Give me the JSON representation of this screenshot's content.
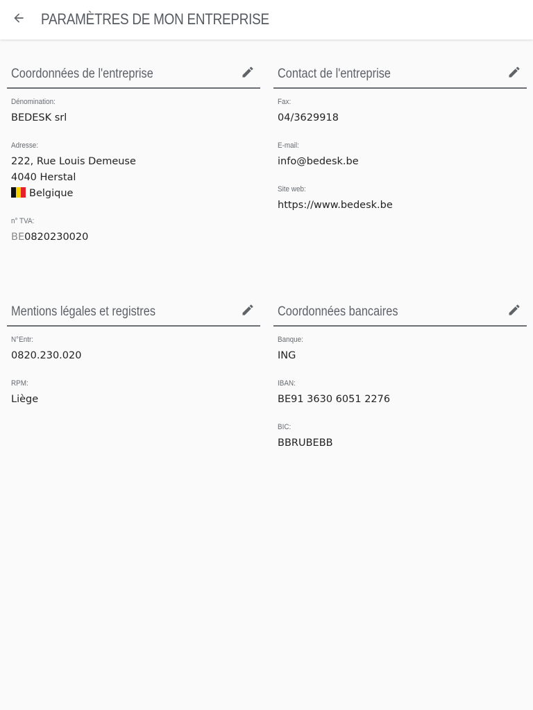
{
  "header": {
    "back_icon": "arrow-left-icon",
    "title": "PARAMÈTRES DE MON ENTREPRISE"
  },
  "colors": {
    "header_bg": "#ffffff",
    "page_bg": "#fafafa",
    "title_text": "#555a60",
    "divider": "#6b6f74",
    "icon": "#5f6368"
  },
  "company": {
    "title": "Coordonnées de l'entreprise",
    "edit_icon": "pencil-icon",
    "name_label": "Dénomination:",
    "name": "BEDESK srl",
    "address_label": "Adresse:",
    "address_line1": "222, Rue Louis Demeuse",
    "address_line2": "4040 Herstal",
    "country": "Belgique",
    "country_flag": "belgium-flag-icon",
    "vat_label": "n° TVA:",
    "vat_prefix": "BE",
    "vat_number": "0820230020"
  },
  "contact": {
    "title": "Contact de l'entreprise",
    "edit_icon": "pencil-icon",
    "fax_label": "Fax:",
    "fax": "04/3629918",
    "email_label": "E-mail:",
    "email": "info@bedesk.be",
    "website_label": "Site web:",
    "website": "https://www.bedesk.be"
  },
  "legal": {
    "title": "Mentions légales et registres",
    "edit_icon": "pencil-icon",
    "entr_label": "N°Entr:",
    "entr": "0820.230.020",
    "rpm_label": "RPM:",
    "rpm": "Liège"
  },
  "bank": {
    "title": "Coordonnées bancaires",
    "edit_icon": "pencil-icon",
    "bank_label": "Banque:",
    "bank": "ING",
    "iban_label": "IBAN:",
    "iban": "BE91 3630 6051 2276",
    "bic_label": "BIC:",
    "bic": "BBRUBEBB"
  }
}
